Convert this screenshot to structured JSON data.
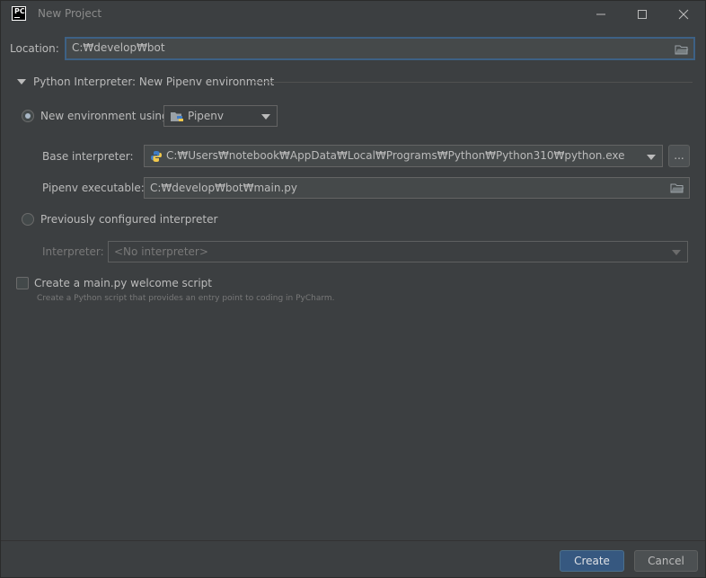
{
  "window": {
    "app_logo": "PC",
    "title": "New Project"
  },
  "location": {
    "label": "Location:",
    "value": "C:₩develop₩bot"
  },
  "interpreter_section": {
    "title": "Python Interpreter: New Pipenv environment"
  },
  "new_env": {
    "label": "New environment using",
    "tool": "Pipenv"
  },
  "base_interpreter": {
    "label": "Base interpreter:",
    "value": "C:₩Users₩notebook₩AppData₩Local₩Programs₩Python₩Python310₩python.exe",
    "browse": "..."
  },
  "pipenv_exec": {
    "label": "Pipenv executable:",
    "value": "C:₩develop₩bot₩main.py"
  },
  "previous": {
    "label": "Previously configured interpreter",
    "interpreter_label": "Interpreter:",
    "interpreter_placeholder": "<No interpreter>"
  },
  "welcome": {
    "label": "Create a main.py welcome script",
    "hint": "Create a Python script that provides an entry point to coding in PyCharm."
  },
  "buttons": {
    "create": "Create",
    "cancel": "Cancel"
  },
  "colors": {
    "background": "#3c3f41",
    "accent": "#365880",
    "focus_border": "#3d6185"
  }
}
